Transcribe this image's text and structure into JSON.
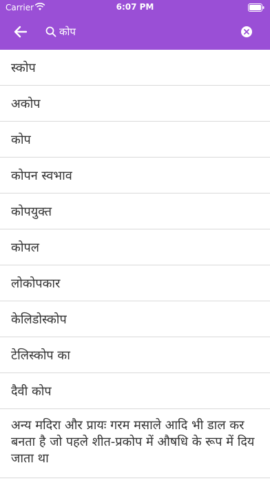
{
  "status_bar": {
    "carrier": "Carrier",
    "time": "6:07 PM"
  },
  "search": {
    "value": "कोप",
    "icons": {
      "back": "arrow-left-icon",
      "search": "search-icon",
      "clear": "clear-icon"
    }
  },
  "colors": {
    "header": "#9a4fd6",
    "divider": "#d9d9d9",
    "text": "#333333"
  },
  "results": [
    "स्कोप",
    "अकोप",
    "कोप",
    "कोपन स्वभाव",
    "कोपयुक्त",
    "कोपल",
    "लोकोपकार",
    "केलिडोस्कोप",
    "टेलिस्कोप का",
    "दैवी कोप",
    "अन्य मदिरा और प्रायः गरम मसाले आदि भी डाल कर बनता है जो पहले शीत-प्रकोप में औषधि के रूप में दिय जाता था"
  ]
}
